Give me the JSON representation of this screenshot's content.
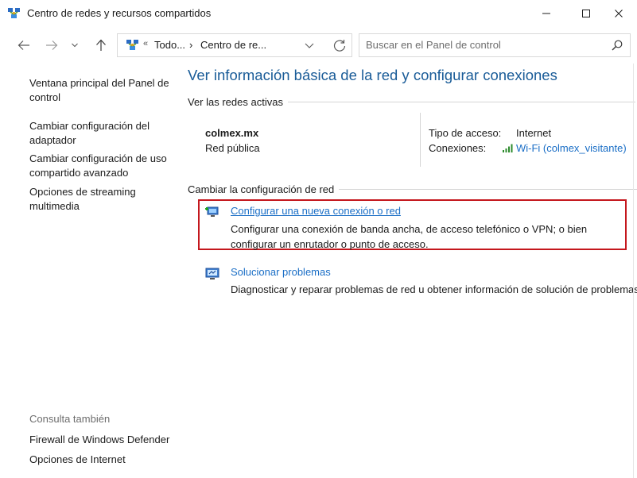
{
  "window": {
    "title": "Centro de redes y recursos compartidos",
    "controls": {
      "minimize": "minimize-icon",
      "maximize": "maximize-icon",
      "close": "close-icon"
    }
  },
  "nav": {
    "breadcrumb_overflow": "«",
    "breadcrumb_1": "Todo...",
    "breadcrumb_separator": "›",
    "breadcrumb_2": "Centro de re...",
    "search_placeholder": "Buscar en el Panel de control"
  },
  "sidebar": {
    "items": [
      {
        "label": "Ventana principal del Panel de control"
      },
      {
        "label": "Cambiar configuración del adaptador"
      },
      {
        "label": "Cambiar configuración de uso compartido avanzado"
      },
      {
        "label": "Opciones de streaming multimedia"
      }
    ],
    "see_also_heading": "Consulta también",
    "see_also": [
      {
        "label": "Firewall de Windows Defender"
      },
      {
        "label": "Opciones de Internet"
      }
    ]
  },
  "main": {
    "title": "Ver información básica de la red y configurar conexiones",
    "active_networks_heading": "Ver las redes activas",
    "network": {
      "name": "colmex.mx",
      "category": "Red pública",
      "access_type_label": "Tipo de acceso:",
      "access_type_value": "Internet",
      "connections_label": "Conexiones:",
      "connections_value": "Wi-Fi (colmex_visitante)"
    },
    "change_settings_heading": "Cambiar la configuración de red",
    "tasks": [
      {
        "link": "Configurar una nueva conexión o red",
        "description": "Configurar una conexión de banda ancha, de acceso telefónico o VPN; o bien configurar un enrutador o punto de acceso.",
        "highlighted": true
      },
      {
        "link": "Solucionar problemas",
        "description": "Diagnosticar y reparar problemas de red u obtener información de solución de problemas.",
        "highlighted": false
      }
    ]
  },
  "colors": {
    "accent_link": "#1a6ec6",
    "title_blue": "#1a5c98",
    "highlight_border": "#c4171d"
  }
}
